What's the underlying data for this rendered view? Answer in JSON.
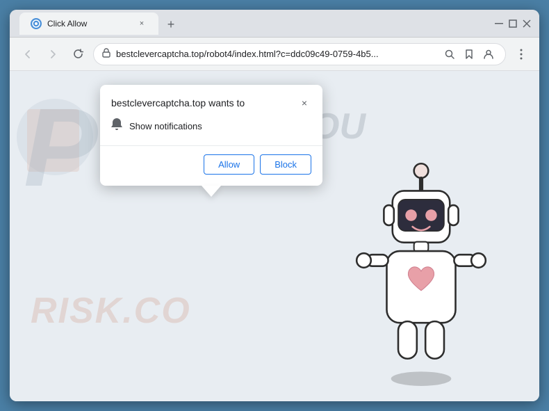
{
  "browser": {
    "title": "Click Allow",
    "tab_favicon": "⊕",
    "tab_close": "×",
    "new_tab_btn": "+",
    "window_minimize": "—",
    "window_maximize": "☐",
    "window_close": "✕",
    "window_restore": "❐"
  },
  "address_bar": {
    "url_secure": "🔒",
    "url_text": "bestclevercaptcha.top/robot4/index.html?c=ddc09c49-0759-4b5...",
    "search_icon": "⌕",
    "bookmark_icon": "☆",
    "profile_icon": "👤",
    "menu_icon": "⋮"
  },
  "nav": {
    "back": "←",
    "forward": "→",
    "reload": "↺"
  },
  "popup": {
    "title": "bestclevercaptcha.top wants to",
    "notification_label": "Show notifications",
    "close_btn": "×",
    "allow_btn": "Allow",
    "block_btn": "Block"
  },
  "page": {
    "you_text": "OU",
    "watermark_large": "PTT",
    "watermark_small": "RISK.CO"
  }
}
